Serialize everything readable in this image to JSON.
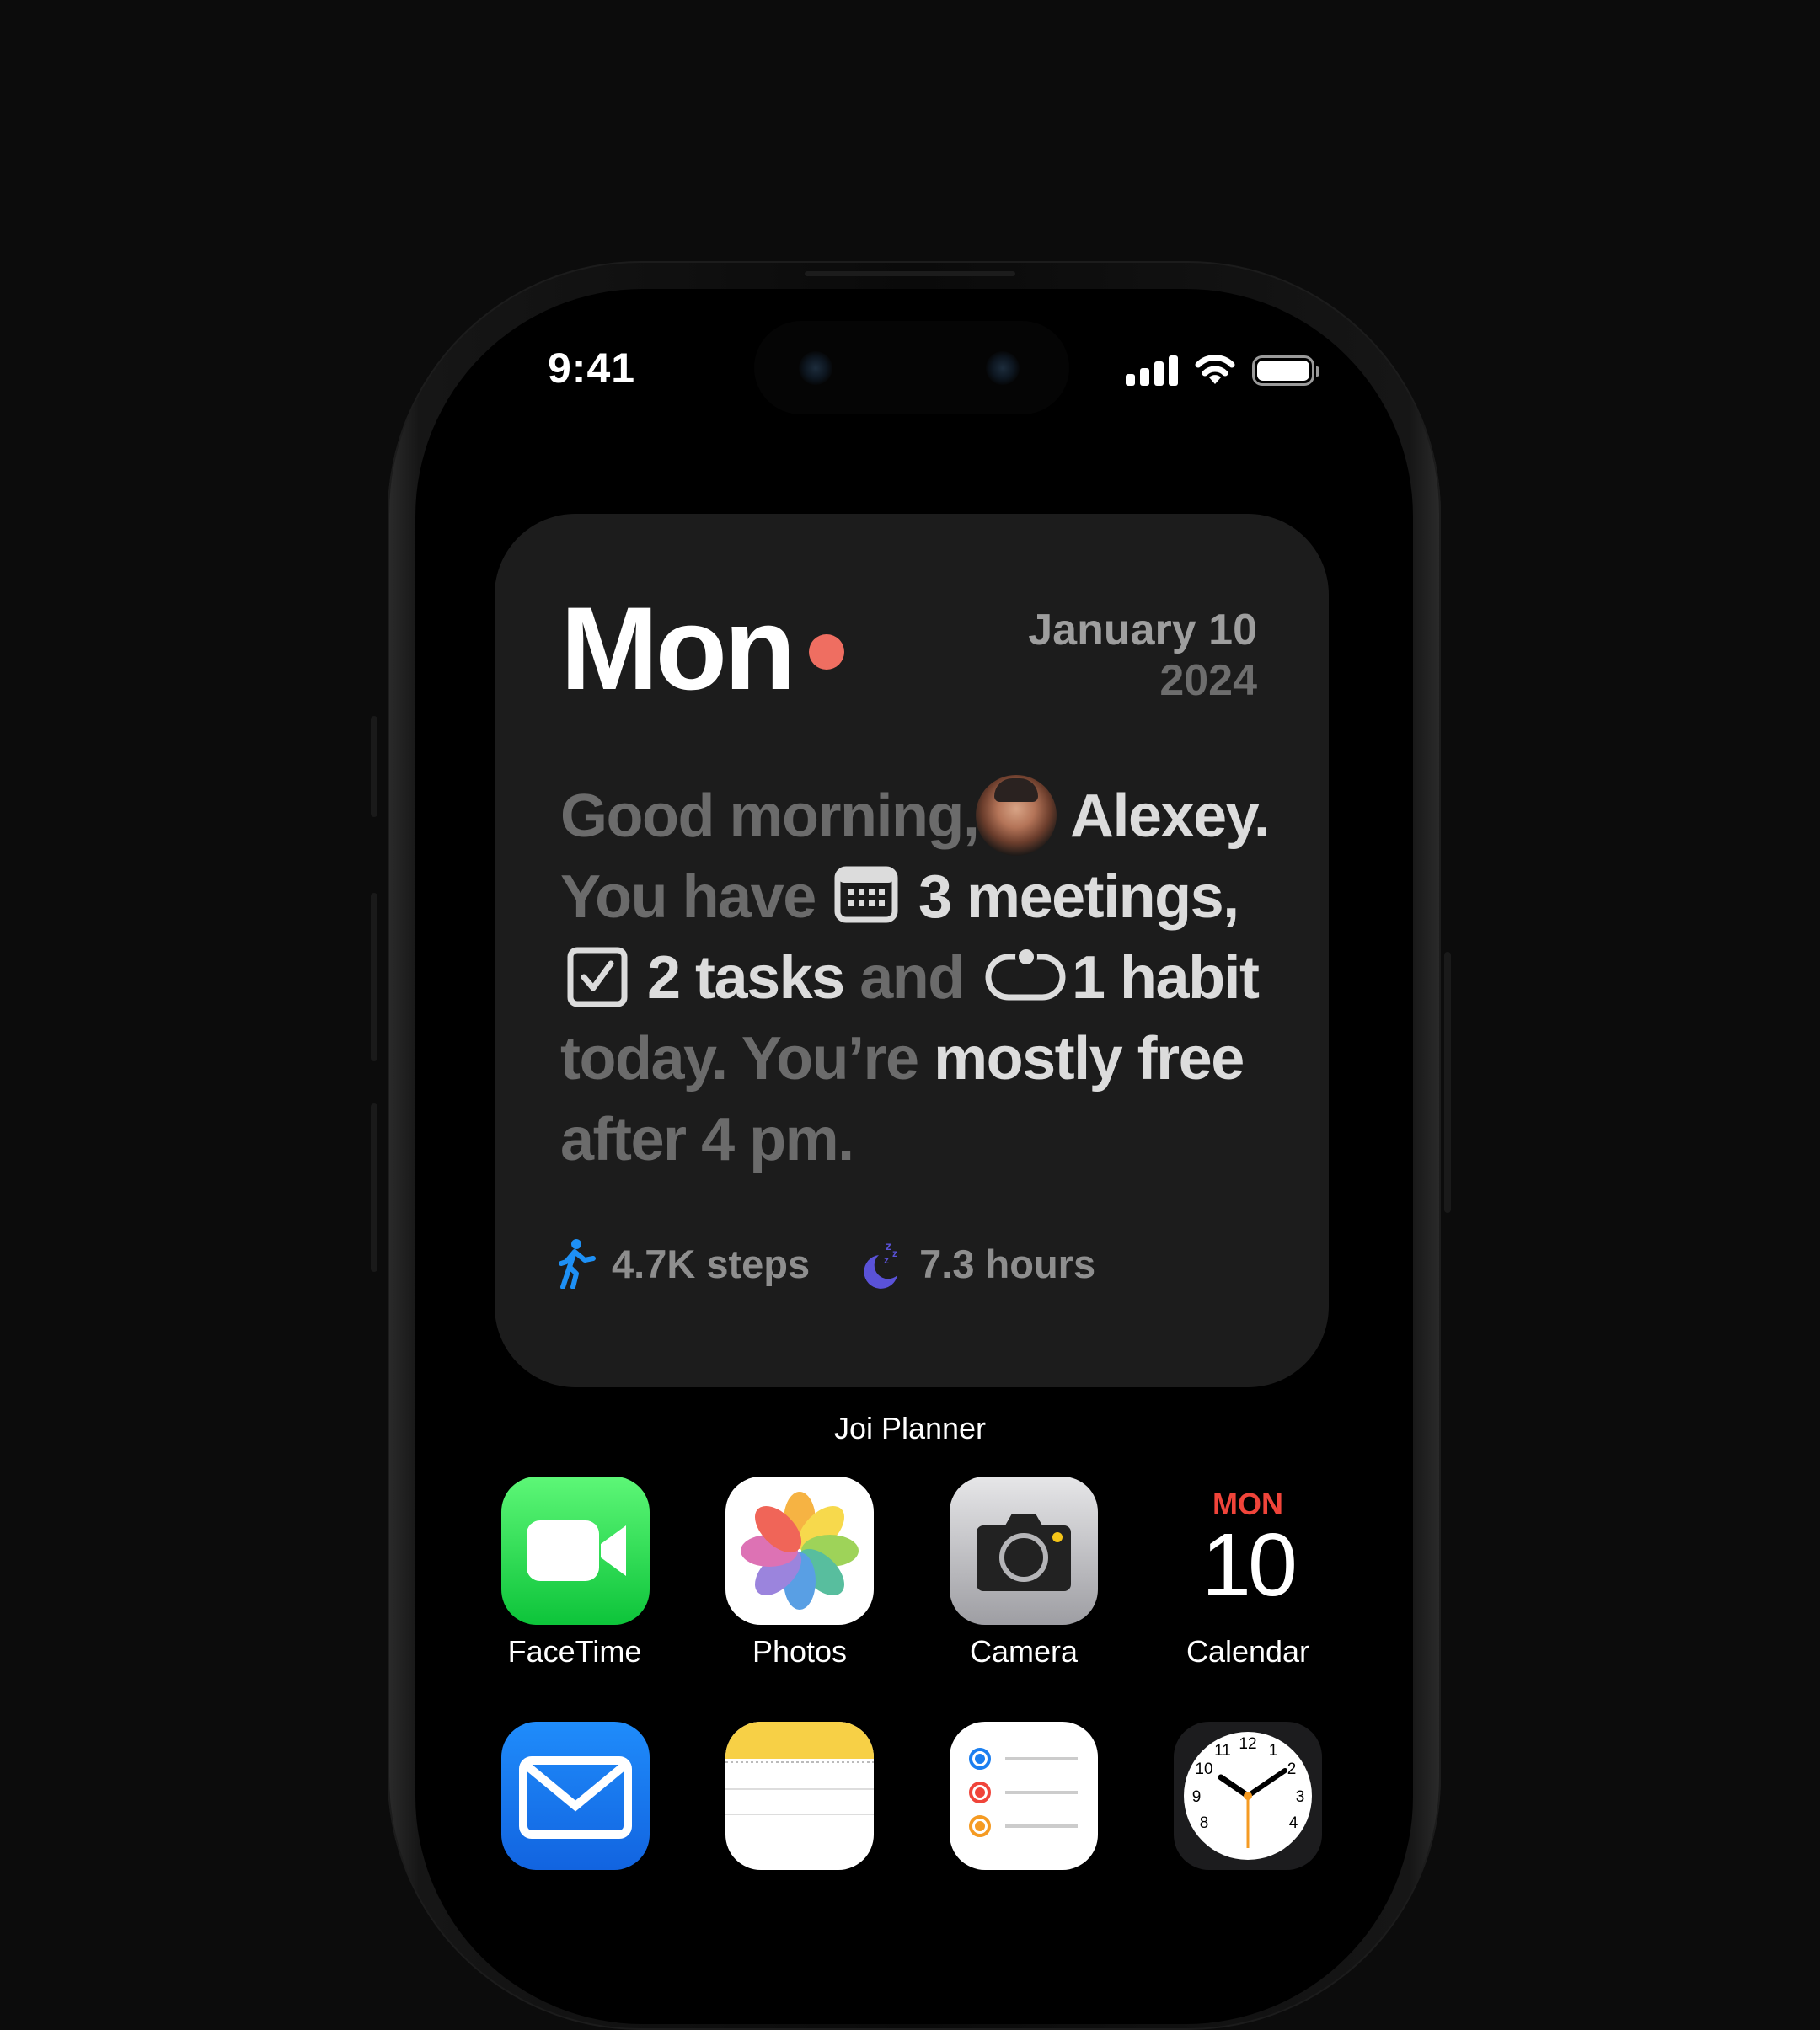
{
  "status_bar": {
    "time": "9:41"
  },
  "widget": {
    "day": "Mon",
    "date_line1": "January 10",
    "date_line2": "2024",
    "greeting_prefix": "Good morning,",
    "user_name": "Alexey.",
    "you_have": "You have",
    "meetings": "3 meetings,",
    "tasks": "2 tasks",
    "and": "and",
    "habit": "1 habit",
    "today_prefix": "today. You’re",
    "mostly_free": "mostly free",
    "after": "after 4 pm.",
    "steps": "4.7K steps",
    "sleep": "7.3 hours",
    "accent_color": "#ef6e61"
  },
  "widget_label": "Joi Planner",
  "apps": [
    {
      "label": "FaceTime",
      "icon": "facetime-icon"
    },
    {
      "label": "Photos",
      "icon": "photos-icon"
    },
    {
      "label": "Camera",
      "icon": "camera-icon"
    },
    {
      "label": "Calendar",
      "icon": "calendar-icon",
      "weekday": "MON",
      "day": "10"
    },
    {
      "label": "",
      "icon": "mail-icon"
    },
    {
      "label": "",
      "icon": "notes-icon"
    },
    {
      "label": "",
      "icon": "reminders-icon"
    },
    {
      "label": "",
      "icon": "clock-icon"
    }
  ],
  "clock_numbers": [
    "12",
    "1",
    "2",
    "3",
    "4",
    "8",
    "9",
    "10",
    "11"
  ]
}
